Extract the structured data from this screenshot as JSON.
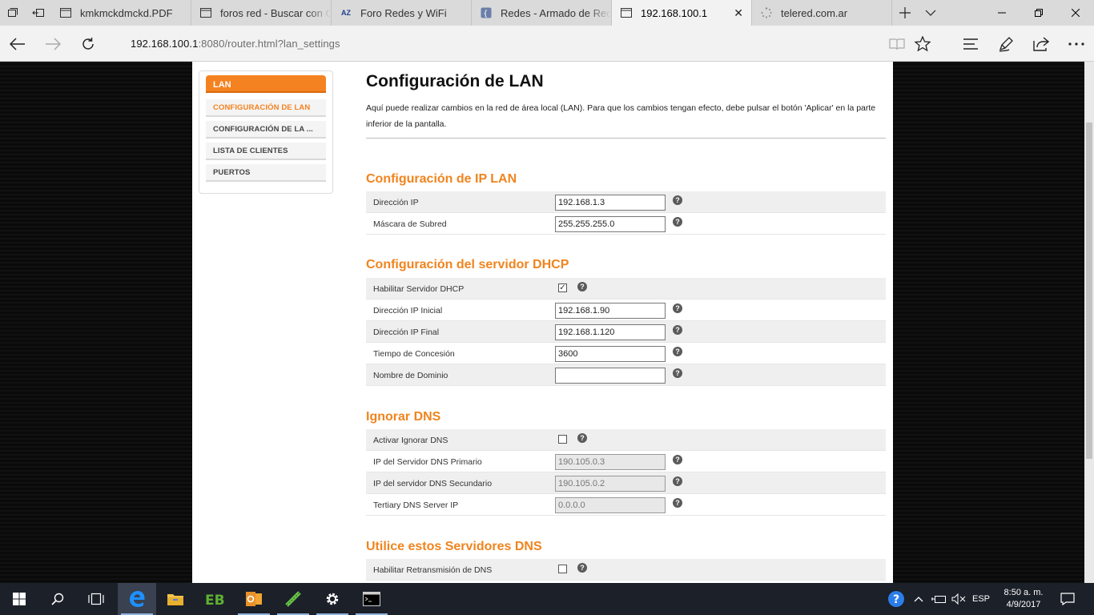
{
  "tabs": [
    {
      "title": "kmkmckdmckd.PDF",
      "icon": "document-icon",
      "active": false
    },
    {
      "title": "foros red - Buscar con C",
      "icon": "document-icon",
      "active": false
    },
    {
      "title": "Foro Redes y WiFi",
      "icon": "az-logo-icon",
      "active": false
    },
    {
      "title": "Redes - Armado de Rec",
      "icon": "site-logo-icon",
      "active": false
    },
    {
      "title": "192.168.100.1",
      "icon": "document-icon",
      "active": true
    },
    {
      "title": "telered.com.ar",
      "icon": "loading-icon",
      "active": false
    }
  ],
  "address": {
    "host": "192.168.100.1",
    "path": ":8080/router.html?lan_settings"
  },
  "sidebar": {
    "header": "LAN",
    "items": [
      {
        "label": "CONFIGURACIÓN DE LAN",
        "active": true
      },
      {
        "label": "CONFIGURACIÓN DE LA ...",
        "active": false
      },
      {
        "label": "LISTA DE CLIENTES",
        "active": false
      },
      {
        "label": "PUERTOS",
        "active": false
      }
    ]
  },
  "main": {
    "title": "Configuración de LAN",
    "description": "Aquí puede realizar cambios en la red de área local (LAN). Para que los cambios tengan efecto, debe pulsar el botón 'Aplicar' en la parte inferior de la pantalla.",
    "sections": {
      "ip_lan": {
        "title": "Configuración de IP LAN",
        "ip_label": "Dirección IP",
        "ip_value": "192.168.1.3",
        "mask_label": "Máscara de Subred",
        "mask_value": "255.255.255.0"
      },
      "dhcp": {
        "title": "Configuración del servidor DHCP",
        "enable_label": "Habilitar Servidor DHCP",
        "enable_checked": true,
        "start_label": "Dirección IP Inicial",
        "start_value": "192.168.1.90",
        "end_label": "Dirección IP Final",
        "end_value": "192.168.1.120",
        "lease_label": "Tiempo de Concesión",
        "lease_value": "3600",
        "domain_label": "Nombre de Dominio",
        "domain_value": ""
      },
      "ignore_dns": {
        "title": "Ignorar DNS",
        "enable_label": "Activar Ignorar DNS",
        "enable_checked": false,
        "primary_label": "IP del Servidor DNS Primario",
        "primary_value": "190.105.0.3",
        "secondary_label": "IP del servidor DNS Secundario",
        "secondary_value": "190.105.0.2",
        "tertiary_label": "Tertiary DNS Server IP",
        "tertiary_value": "0.0.0.0"
      },
      "use_dns": {
        "title": "Utilice estos Servidores DNS",
        "relay_label": "Habilitar Retransmisión de DNS",
        "relay_checked": false
      }
    },
    "help_symbol": "?"
  },
  "taskbar": {
    "language": "ESP",
    "time": "8:50 a. m.",
    "date": "4/9/2017"
  },
  "colors": {
    "accent": "#f58220",
    "section_title": "#f0841e"
  }
}
